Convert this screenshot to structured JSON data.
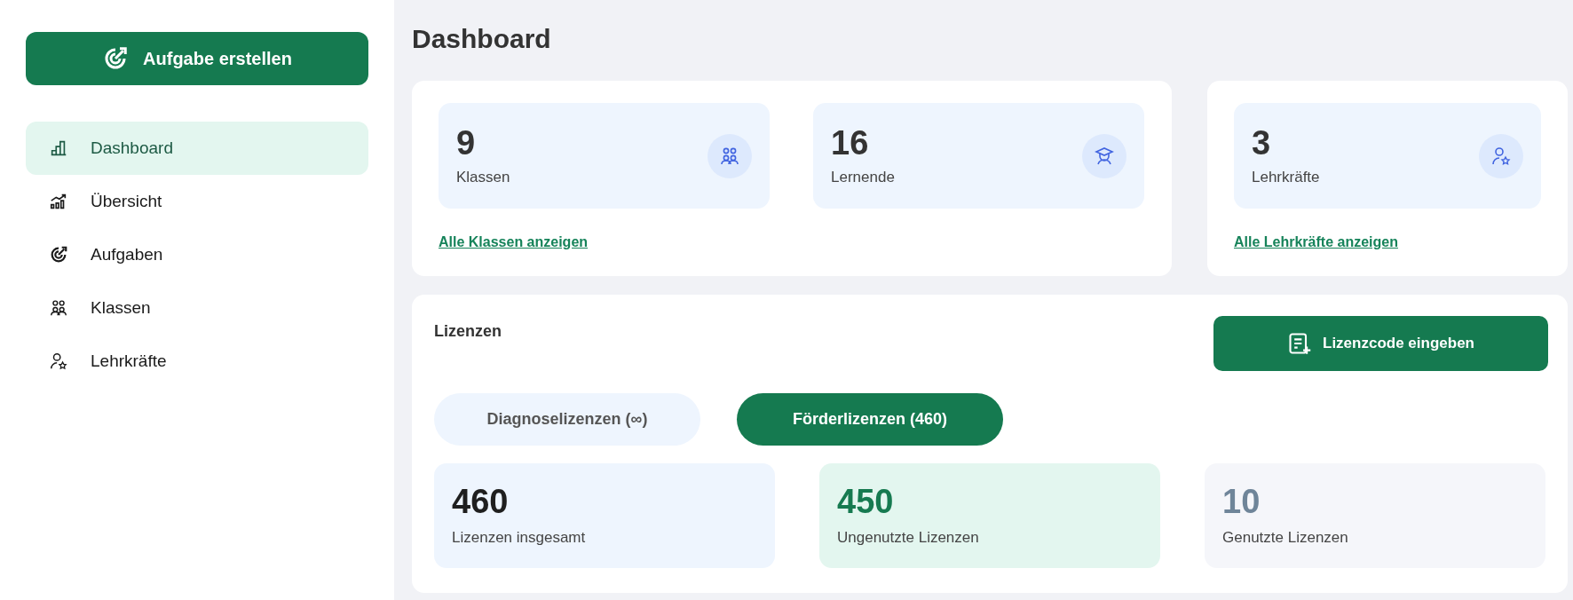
{
  "sidebar": {
    "create_button": "Aufgabe erstellen",
    "items": [
      {
        "label": "Dashboard",
        "kind": "bars",
        "selected": true
      },
      {
        "label": "Übersicht",
        "kind": "trend",
        "selected": false
      },
      {
        "label": "Aufgaben",
        "kind": "target",
        "selected": false
      },
      {
        "label": "Klassen",
        "kind": "group",
        "selected": false
      },
      {
        "label": "Lehrkräfte",
        "kind": "teacher",
        "selected": false
      }
    ]
  },
  "title": "Dashboard",
  "overview_cards": [
    {
      "stats": [
        {
          "value": "9",
          "label": "Klassen",
          "kind": "group"
        },
        {
          "value": "16",
          "label": "Lernende",
          "kind": "student"
        }
      ],
      "link": "Alle Klassen anzeigen"
    },
    {
      "stats": [
        {
          "value": "3",
          "label": "Lehrkräfte",
          "kind": "teacher"
        }
      ],
      "link": "Alle Lehrkräfte anzeigen"
    }
  ],
  "licenses": {
    "title": "Lizenzen",
    "button": "Lizenzcode eingeben",
    "tabs": [
      {
        "label": "Diagnoselizenzen (∞)",
        "selected": false
      },
      {
        "label": "Förderlizenzen (460)",
        "selected": true
      }
    ],
    "stats": [
      {
        "kind": "total",
        "value": "460",
        "label": "Lizenzen insgesamt"
      },
      {
        "kind": "unused",
        "value": "450",
        "label": "Ungenutzte Lizenzen"
      },
      {
        "kind": "used",
        "value": "10",
        "label": "Genutzte Lizenzen"
      }
    ]
  }
}
